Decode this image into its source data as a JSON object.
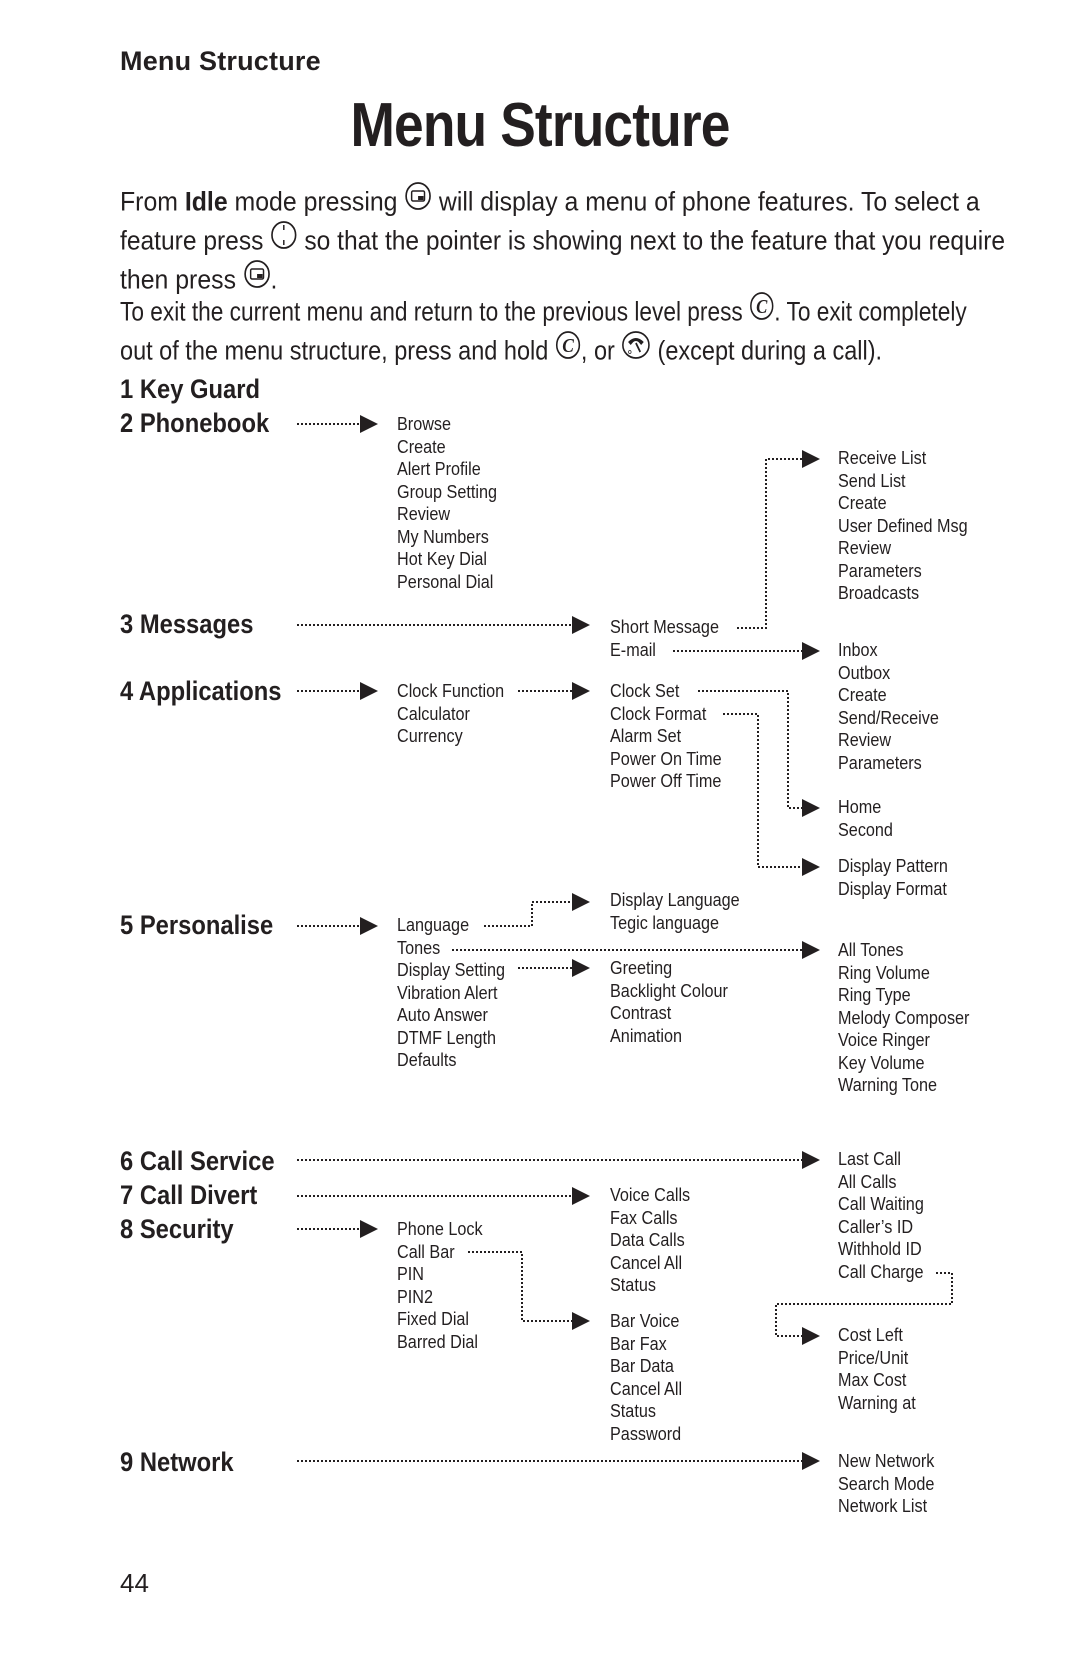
{
  "header": {
    "running_title": "Menu Structure",
    "page_title": "Menu Structure"
  },
  "intro": {
    "para1": {
      "line1_a": "From ",
      "line1_bold": "Idle",
      "line1_b": " mode pressing ",
      "line1_c": " will display a menu of phone features. To select a",
      "line2_a": "feature press ",
      "line2_b": " so that the pointer is showing next to the feature that you require",
      "line3_a": "then press ",
      "line3_b": "."
    },
    "para2": {
      "line1_a": "To exit the current menu and return to the previous level press ",
      "line1_b": ". To exit completely",
      "line2_a": "out of the menu structure, press and hold ",
      "line2_b": ", or ",
      "line2_c": " (except during a call)."
    },
    "icons": [
      "menu-select-key",
      "navigation-key",
      "clear-key",
      "end-call-key"
    ]
  },
  "menu": {
    "top_items": [
      "1 Key Guard",
      "2 Phonebook",
      "3 Messages",
      "4 Applications",
      "5 Personalise",
      "6 Call Service",
      "7 Call Divert",
      "8 Security",
      "9 Network"
    ],
    "phonebook": [
      "Browse",
      "Create",
      "Alert Profile",
      "Group Setting",
      "Review",
      "My Numbers",
      "Hot Key Dial",
      "Personal Dial"
    ],
    "messages": [
      "Short Message",
      "E-mail"
    ],
    "short_message": [
      "Receive List",
      "Send List",
      "Create",
      "User Defined Msg",
      "Review",
      "Parameters",
      "Broadcasts"
    ],
    "email": [
      "Inbox",
      "Outbox",
      "Create",
      "Send/Receive",
      "Review",
      "Parameters"
    ],
    "applications": [
      "Clock Function",
      "Calculator",
      "Currency"
    ],
    "clock_function": [
      "Clock Set",
      "Clock Format",
      "Alarm Set",
      "Power On Time",
      "Power Off Time"
    ],
    "clock_set": [
      "Home",
      "Second"
    ],
    "clock_format": [
      "Display Pattern",
      "Display Format"
    ],
    "personalise": [
      "Language",
      "Tones",
      "Display Setting",
      "Vibration Alert",
      "Auto Answer",
      "DTMF Length",
      "Defaults"
    ],
    "language": [
      "Display Language",
      "Tegic language"
    ],
    "tones": [
      "All Tones",
      "Ring Volume",
      "Ring Type",
      "Melody Composer",
      "Voice Ringer",
      "Key Volume",
      "Warning Tone"
    ],
    "display_setting": [
      "Greeting",
      "Backlight Colour",
      "Contrast",
      "Animation"
    ],
    "call_service": [
      "Last Call",
      "All Calls",
      "Call Waiting",
      "Caller’s ID",
      "Withhold ID",
      "Call Charge"
    ],
    "call_charge": [
      "Cost Left",
      "Price/Unit",
      "Max Cost",
      "Warning at"
    ],
    "call_divert": [
      "Voice Calls",
      "Fax Calls",
      "Data Calls",
      "Cancel All",
      "Status"
    ],
    "security": [
      "Phone Lock",
      "Call Bar",
      "PIN",
      "PIN2",
      "Fixed Dial",
      "Barred Dial"
    ],
    "call_bar": [
      "Bar Voice",
      "Bar Fax",
      "Bar Data",
      "Cancel All",
      "Status",
      "Password"
    ],
    "network": [
      "New Network",
      "Search Mode",
      "Network List"
    ]
  },
  "footer": {
    "page_number": "44"
  }
}
